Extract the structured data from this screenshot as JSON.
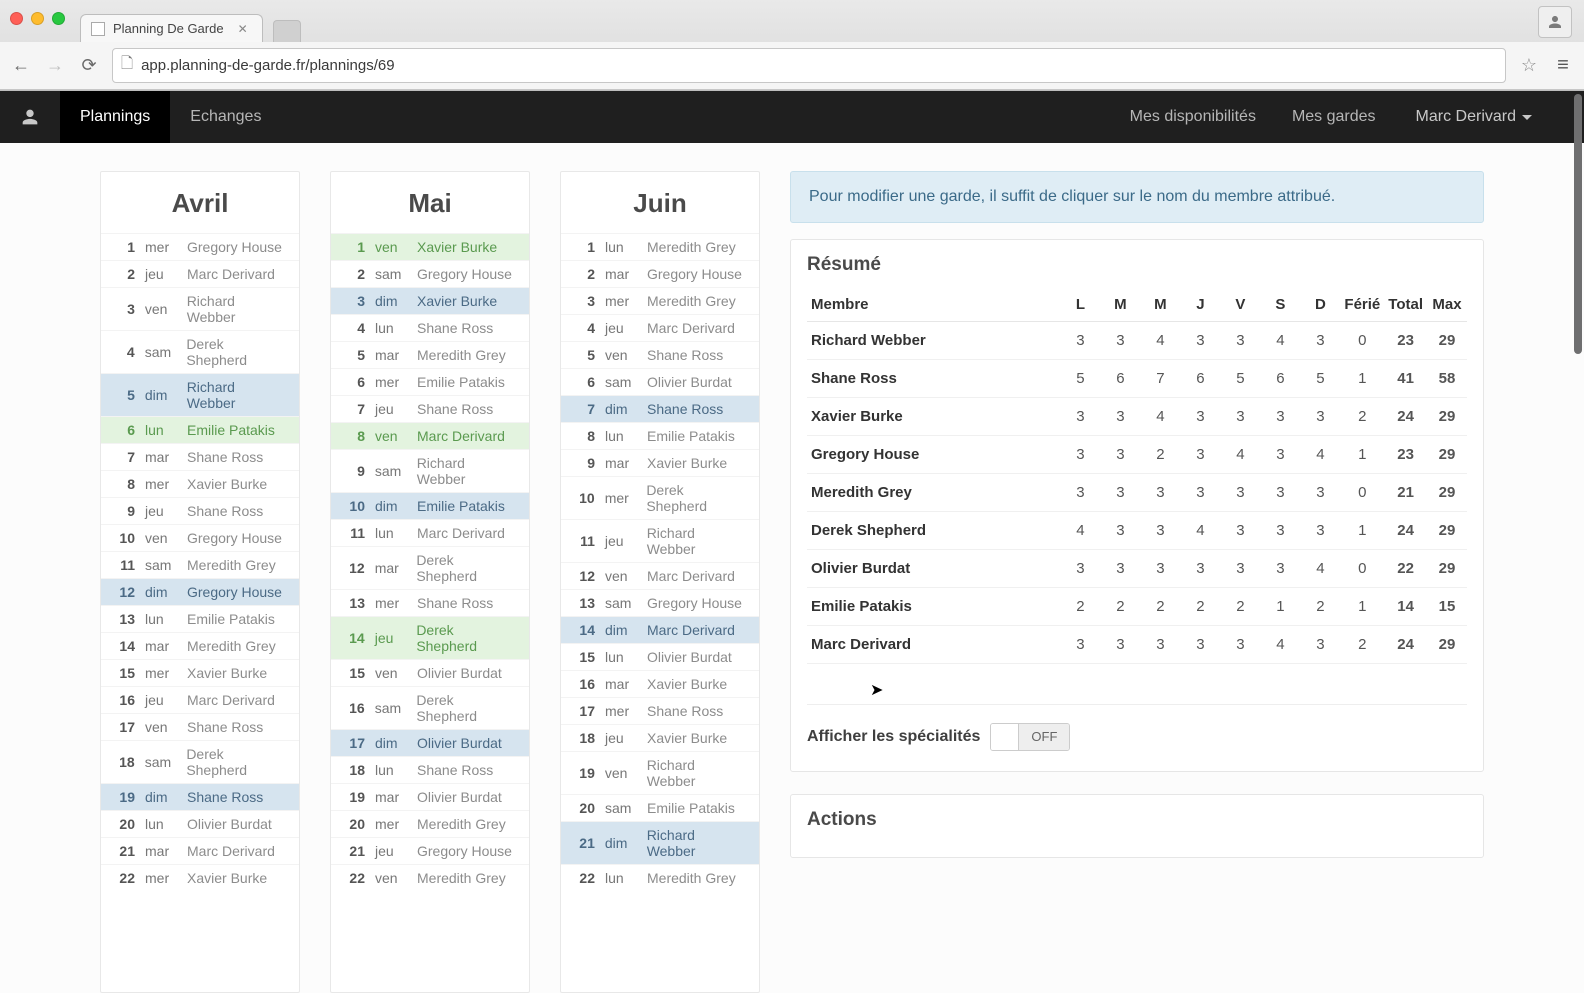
{
  "browser": {
    "tab_title": "Planning De Garde",
    "url": "app.planning-de-garde.fr/plannings/69"
  },
  "navbar": {
    "items": [
      "Plannings",
      "Echanges"
    ],
    "right_items": [
      "Mes disponibilités",
      "Mes gardes"
    ],
    "user": "Marc Derivard"
  },
  "info_banner": "Pour modifier une garde, il suffit de cliquer sur le nom du membre attribué.",
  "months": [
    {
      "title": "Avril",
      "days": [
        {
          "n": "1",
          "dow": "mer",
          "name": "Gregory House",
          "hl": ""
        },
        {
          "n": "2",
          "dow": "jeu",
          "name": "Marc Derivard",
          "hl": ""
        },
        {
          "n": "3",
          "dow": "ven",
          "name": "Richard Webber",
          "hl": ""
        },
        {
          "n": "4",
          "dow": "sam",
          "name": "Derek Shepherd",
          "hl": ""
        },
        {
          "n": "5",
          "dow": "dim",
          "name": "Richard Webber",
          "hl": "blue"
        },
        {
          "n": "6",
          "dow": "lun",
          "name": "Emilie Patakis",
          "hl": "green"
        },
        {
          "n": "7",
          "dow": "mar",
          "name": "Shane Ross",
          "hl": ""
        },
        {
          "n": "8",
          "dow": "mer",
          "name": "Xavier Burke",
          "hl": ""
        },
        {
          "n": "9",
          "dow": "jeu",
          "name": "Shane Ross",
          "hl": ""
        },
        {
          "n": "10",
          "dow": "ven",
          "name": "Gregory House",
          "hl": ""
        },
        {
          "n": "11",
          "dow": "sam",
          "name": "Meredith Grey",
          "hl": ""
        },
        {
          "n": "12",
          "dow": "dim",
          "name": "Gregory House",
          "hl": "blue"
        },
        {
          "n": "13",
          "dow": "lun",
          "name": "Emilie Patakis",
          "hl": ""
        },
        {
          "n": "14",
          "dow": "mar",
          "name": "Meredith Grey",
          "hl": ""
        },
        {
          "n": "15",
          "dow": "mer",
          "name": "Xavier Burke",
          "hl": ""
        },
        {
          "n": "16",
          "dow": "jeu",
          "name": "Marc Derivard",
          "hl": ""
        },
        {
          "n": "17",
          "dow": "ven",
          "name": "Shane Ross",
          "hl": ""
        },
        {
          "n": "18",
          "dow": "sam",
          "name": "Derek Shepherd",
          "hl": ""
        },
        {
          "n": "19",
          "dow": "dim",
          "name": "Shane Ross",
          "hl": "blue"
        },
        {
          "n": "20",
          "dow": "lun",
          "name": "Olivier Burdat",
          "hl": ""
        },
        {
          "n": "21",
          "dow": "mar",
          "name": "Marc Derivard",
          "hl": ""
        },
        {
          "n": "22",
          "dow": "mer",
          "name": "Xavier Burke",
          "hl": ""
        }
      ]
    },
    {
      "title": "Mai",
      "days": [
        {
          "n": "1",
          "dow": "ven",
          "name": "Xavier Burke",
          "hl": "green"
        },
        {
          "n": "2",
          "dow": "sam",
          "name": "Gregory House",
          "hl": ""
        },
        {
          "n": "3",
          "dow": "dim",
          "name": "Xavier Burke",
          "hl": "blue"
        },
        {
          "n": "4",
          "dow": "lun",
          "name": "Shane Ross",
          "hl": ""
        },
        {
          "n": "5",
          "dow": "mar",
          "name": "Meredith Grey",
          "hl": ""
        },
        {
          "n": "6",
          "dow": "mer",
          "name": "Emilie Patakis",
          "hl": ""
        },
        {
          "n": "7",
          "dow": "jeu",
          "name": "Shane Ross",
          "hl": ""
        },
        {
          "n": "8",
          "dow": "ven",
          "name": "Marc Derivard",
          "hl": "green"
        },
        {
          "n": "9",
          "dow": "sam",
          "name": "Richard Webber",
          "hl": ""
        },
        {
          "n": "10",
          "dow": "dim",
          "name": "Emilie Patakis",
          "hl": "blue"
        },
        {
          "n": "11",
          "dow": "lun",
          "name": "Marc Derivard",
          "hl": ""
        },
        {
          "n": "12",
          "dow": "mar",
          "name": "Derek Shepherd",
          "hl": ""
        },
        {
          "n": "13",
          "dow": "mer",
          "name": "Shane Ross",
          "hl": ""
        },
        {
          "n": "14",
          "dow": "jeu",
          "name": "Derek Shepherd",
          "hl": "green"
        },
        {
          "n": "15",
          "dow": "ven",
          "name": "Olivier Burdat",
          "hl": ""
        },
        {
          "n": "16",
          "dow": "sam",
          "name": "Derek Shepherd",
          "hl": ""
        },
        {
          "n": "17",
          "dow": "dim",
          "name": "Olivier Burdat",
          "hl": "blue"
        },
        {
          "n": "18",
          "dow": "lun",
          "name": "Shane Ross",
          "hl": ""
        },
        {
          "n": "19",
          "dow": "mar",
          "name": "Olivier Burdat",
          "hl": ""
        },
        {
          "n": "20",
          "dow": "mer",
          "name": "Meredith Grey",
          "hl": ""
        },
        {
          "n": "21",
          "dow": "jeu",
          "name": "Gregory House",
          "hl": ""
        },
        {
          "n": "22",
          "dow": "ven",
          "name": "Meredith Grey",
          "hl": ""
        }
      ]
    },
    {
      "title": "Juin",
      "days": [
        {
          "n": "1",
          "dow": "lun",
          "name": "Meredith Grey",
          "hl": ""
        },
        {
          "n": "2",
          "dow": "mar",
          "name": "Gregory House",
          "hl": ""
        },
        {
          "n": "3",
          "dow": "mer",
          "name": "Meredith Grey",
          "hl": ""
        },
        {
          "n": "4",
          "dow": "jeu",
          "name": "Marc Derivard",
          "hl": ""
        },
        {
          "n": "5",
          "dow": "ven",
          "name": "Shane Ross",
          "hl": ""
        },
        {
          "n": "6",
          "dow": "sam",
          "name": "Olivier Burdat",
          "hl": ""
        },
        {
          "n": "7",
          "dow": "dim",
          "name": "Shane Ross",
          "hl": "blue"
        },
        {
          "n": "8",
          "dow": "lun",
          "name": "Emilie Patakis",
          "hl": ""
        },
        {
          "n": "9",
          "dow": "mar",
          "name": "Xavier Burke",
          "hl": ""
        },
        {
          "n": "10",
          "dow": "mer",
          "name": "Derek Shepherd",
          "hl": ""
        },
        {
          "n": "11",
          "dow": "jeu",
          "name": "Richard Webber",
          "hl": ""
        },
        {
          "n": "12",
          "dow": "ven",
          "name": "Marc Derivard",
          "hl": ""
        },
        {
          "n": "13",
          "dow": "sam",
          "name": "Gregory House",
          "hl": ""
        },
        {
          "n": "14",
          "dow": "dim",
          "name": "Marc Derivard",
          "hl": "blue"
        },
        {
          "n": "15",
          "dow": "lun",
          "name": "Olivier Burdat",
          "hl": ""
        },
        {
          "n": "16",
          "dow": "mar",
          "name": "Xavier Burke",
          "hl": ""
        },
        {
          "n": "17",
          "dow": "mer",
          "name": "Shane Ross",
          "hl": ""
        },
        {
          "n": "18",
          "dow": "jeu",
          "name": "Xavier Burke",
          "hl": ""
        },
        {
          "n": "19",
          "dow": "ven",
          "name": "Richard Webber",
          "hl": ""
        },
        {
          "n": "20",
          "dow": "sam",
          "name": "Emilie Patakis",
          "hl": ""
        },
        {
          "n": "21",
          "dow": "dim",
          "name": "Richard Webber",
          "hl": "blue"
        },
        {
          "n": "22",
          "dow": "lun",
          "name": "Meredith Grey",
          "hl": ""
        }
      ]
    }
  ],
  "summary": {
    "title": "Résumé",
    "headers": [
      "Membre",
      "L",
      "M",
      "M",
      "J",
      "V",
      "S",
      "D",
      "Férié",
      "Total",
      "Max"
    ],
    "rows": [
      {
        "name": "Richard Webber",
        "vals": [
          "3",
          "3",
          "4",
          "3",
          "3",
          "4",
          "3",
          "0",
          "23",
          "29"
        ]
      },
      {
        "name": "Shane Ross",
        "vals": [
          "5",
          "6",
          "7",
          "6",
          "5",
          "6",
          "5",
          "1",
          "41",
          "58"
        ]
      },
      {
        "name": "Xavier Burke",
        "vals": [
          "3",
          "3",
          "4",
          "3",
          "3",
          "3",
          "3",
          "2",
          "24",
          "29"
        ]
      },
      {
        "name": "Gregory House",
        "vals": [
          "3",
          "3",
          "2",
          "3",
          "4",
          "3",
          "4",
          "1",
          "23",
          "29"
        ]
      },
      {
        "name": "Meredith Grey",
        "vals": [
          "3",
          "3",
          "3",
          "3",
          "3",
          "3",
          "3",
          "0",
          "21",
          "29"
        ]
      },
      {
        "name": "Derek Shepherd",
        "vals": [
          "4",
          "3",
          "3",
          "4",
          "3",
          "3",
          "3",
          "1",
          "24",
          "29"
        ]
      },
      {
        "name": "Olivier Burdat",
        "vals": [
          "3",
          "3",
          "3",
          "3",
          "3",
          "3",
          "4",
          "0",
          "22",
          "29"
        ]
      },
      {
        "name": "Emilie Patakis",
        "vals": [
          "2",
          "2",
          "2",
          "2",
          "2",
          "1",
          "2",
          "1",
          "14",
          "15"
        ]
      },
      {
        "name": "Marc Derivard",
        "vals": [
          "3",
          "3",
          "3",
          "3",
          "3",
          "4",
          "3",
          "2",
          "24",
          "29"
        ]
      }
    ]
  },
  "specialites": {
    "label": "Afficher les spécialités",
    "state": "OFF"
  },
  "actions": {
    "title": "Actions"
  }
}
